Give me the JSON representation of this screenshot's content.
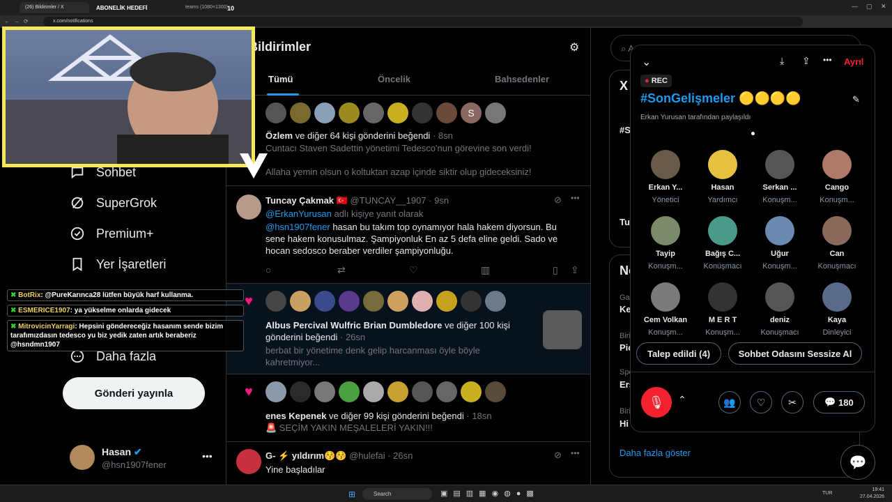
{
  "browser": {
    "tabs": [
      "(26) Bildirimler / X",
      "ABONELİK HEDEFİ",
      "teams (1080×1300)",
      "10"
    ],
    "url": "x.com/notifications"
  },
  "sidebar": {
    "items": [
      {
        "label": "Sohbet",
        "icon": "chat-icon"
      },
      {
        "label": "SuperGrok",
        "icon": "grok-icon"
      },
      {
        "label": "Premium+",
        "icon": "verified-icon"
      },
      {
        "label": "Yer İşaretleri",
        "icon": "bookmark-icon"
      },
      {
        "label": "Daha fazla",
        "icon": "more-circle-icon"
      }
    ],
    "post_button": "Gönderi yayınla",
    "profile": {
      "name": "Hasan",
      "handle": "@hsn1907fener"
    }
  },
  "feed": {
    "title": "Bildirimler",
    "tabs": [
      "Tümü",
      "Öncelik",
      "Bahsedenler"
    ],
    "n1": {
      "text_bold": "Özlem",
      "text": " ve diğer 64 kişi gönderini beğendi",
      "time": "8sn",
      "line1": "Cuntacı Staven Sadettin yönetimi Tedesco'nun görevine son verdi!",
      "line2": "Allaha yemin olsun o koltuktan azap içinde siktir olup gideceksiniz!"
    },
    "n2": {
      "name": "Tuncay Çakmak",
      "handle": "@TUNCAY__1907",
      "time": "9sn",
      "reply_to": "@ErkanYurusan",
      "reply_suffix": " adlı kişiye yanıt olarak",
      "mention": "@hsn1907fener",
      "body": " hasan bu takım top oynamıyor hala hakem diyorsun. Bu sene hakem konusulmaz. Şampiyonluk En az 5 defa eline geldi. Sado ve hocan sedosco beraber verdiler şampiyonluğu."
    },
    "n3": {
      "text_bold": "Albus Percival Wulfric Brian Dumbledore",
      "text": " ve diğer 100 kişi gönderini beğendi",
      "time": "26sn",
      "line1": "berbat bir yönetime denk gelip harcanması öyle böyle",
      "line2": "kahretmiyor..."
    },
    "n4": {
      "text_bold": "enes Kepenek",
      "text": " ve diğer 99 kişi gönderini beğendi",
      "time": "18sn",
      "line1": "🚨 SEÇİM YAKIN MEŞALELERİ YAKIN!!!"
    },
    "n5": {
      "name": "G- ⚡ yıldırım😚😚",
      "handle": "@hulefai",
      "time": "26sn",
      "body": "Yine başladılar"
    }
  },
  "right": {
    "search_placeholder": "A",
    "show_more": "Daha fazla göster",
    "snips": [
      "X",
      "#S",
      "Tu",
      "No",
      "Ga",
      "Ke",
      "Biri",
      "Pic",
      "Spo",
      "Ers",
      "Biri",
      "Hi"
    ]
  },
  "space": {
    "rec": "REC",
    "leave": "Ayrıl",
    "title": "#SonGelişmeler 🟡🟡🟡🟡",
    "shared_by": "Erkan Yurusan tarafından paylaşıldı",
    "participants": [
      {
        "name": "Erkan Y...",
        "role": "Yönetici"
      },
      {
        "name": "Hasan",
        "role": "Yardımcı"
      },
      {
        "name": "Serkan ...",
        "role": "Konuşm..."
      },
      {
        "name": "Cango",
        "role": "Konuşm..."
      },
      {
        "name": "Tayip",
        "role": "Konuşm..."
      },
      {
        "name": "Bağış C...",
        "role": "Konuşmacı"
      },
      {
        "name": "Uğur",
        "role": "Konuşm..."
      },
      {
        "name": "Can",
        "role": "Konuşmacı"
      },
      {
        "name": "Cem Volkan",
        "role": "Konuşm..."
      },
      {
        "name": "M E R T",
        "role": "Konuşm..."
      },
      {
        "name": "deniz",
        "role": "Konuşmacı"
      },
      {
        "name": "Kaya",
        "role": "Dinleyici"
      }
    ],
    "request_btn": "Talep edildi (4)",
    "mute_btn": "Sohbet Odasını Sessize Al",
    "comments": "180"
  },
  "chat": [
    {
      "user": "BotRix",
      "msg": ": @PureKarınca28 lütfen büyük harf kullanma."
    },
    {
      "user": "ESMERICE1907",
      "msg": ": ya yükselme onlarda gidecek"
    },
    {
      "user": "MitrovicinYarragi",
      "msg": ": Hepsini göndereceğiz hasanım sende bizim tarafımızdasın tedesco yu biz yedik zaten artık beraberiz @hsndmn1907"
    }
  ],
  "taskbar": {
    "search": "Search",
    "lang": "TUR",
    "time": "19:41",
    "date": "27.04.2026"
  }
}
